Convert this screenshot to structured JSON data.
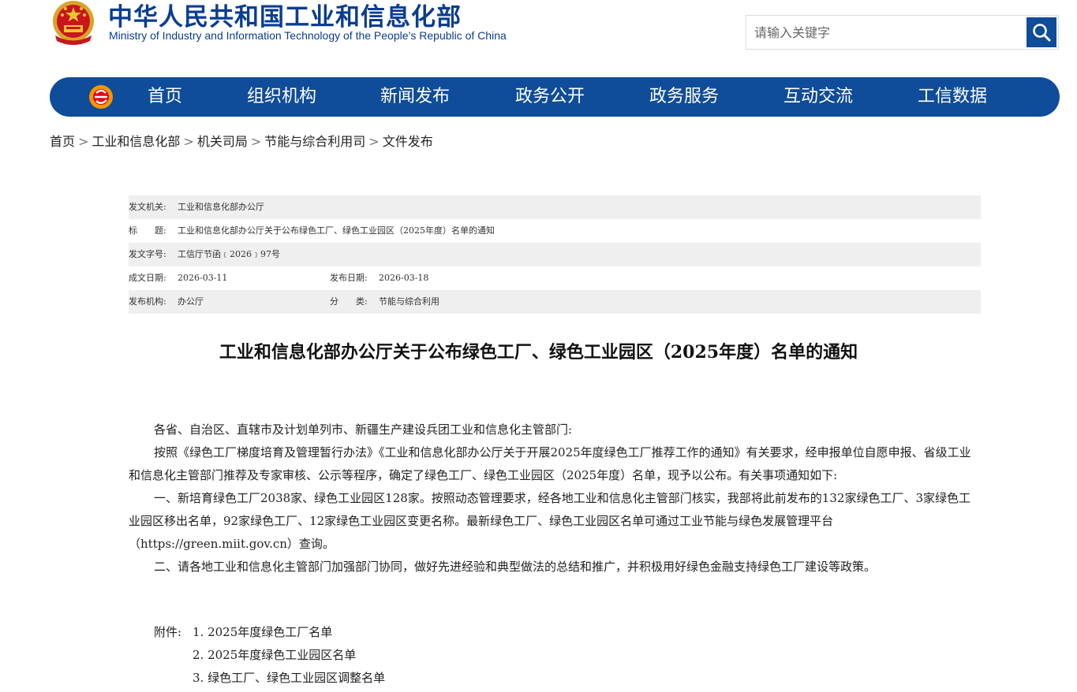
{
  "header": {
    "title_cn": "中华人民共和国工业和信息化部",
    "title_en": "Ministry of Industry and Information Technology of the People’s Republic of China"
  },
  "search": {
    "placeholder": "请输入关键字"
  },
  "nav": {
    "items": [
      "首页",
      "组织机构",
      "新闻发布",
      "政务公开",
      "政务服务",
      "互动交流",
      "工信数据"
    ]
  },
  "breadcrumb": {
    "items": [
      "首页",
      "工业和信息化部",
      "机关司局",
      "节能与综合利用司",
      "文件发布"
    ],
    "separator": ">"
  },
  "meta": {
    "issuer_label": "发文机关:",
    "issuer": "工业和信息化部办公厅",
    "subject_label": "标　　题:",
    "subject": "工业和信息化部办公厅关于公布绿色工厂、绿色工业园区（2025年度）名单的通知",
    "docno_label": "发文字号:",
    "docno": "工信厅节函﹝2026﹞97号",
    "written_label": "成文日期:",
    "written": "2026-03-11",
    "published_label": "发布日期:",
    "published": "2026-03-18",
    "org_label": "发布机构:",
    "org": "办公厅",
    "category_label": "分　　类:",
    "category": "节能与综合利用"
  },
  "article": {
    "title": "工业和信息化部办公厅关于公布绿色工厂、绿色工业园区（2025年度）名单的通知",
    "salutation": "各省、自治区、直辖市及计划单列市、新疆生产建设兵团工业和信息化主管部门:",
    "para1": "按照《绿色工厂梯度培育及管理暂行办法》《工业和信息化部办公厅关于开展2025年度绿色工厂推荐工作的通知》有关要求，经申报单位自愿申报、省级工业和信息化主管部门推荐及专家审核、公示等程序，确定了绿色工厂、绿色工业园区（2025年度）名单，现予以公布。有关事项通知如下:",
    "para2": "一、新培育绿色工厂2038家、绿色工业园区128家。按照动态管理要求，经各地工业和信息化主管部门核实，我部将此前发布的132家绿色工厂、3家绿色工业园区移出名单，92家绿色工厂、12家绿色工业园区变更名称。最新绿色工厂、绿色工业园区名单可通过工业节能与绿色发展管理平台（https://green.miit.gov.cn）查询。",
    "para3": "二、请各地工业和信息化主管部门加强部门协同，做好先进经验和典型做法的总结和推广，并积极用好绿色金融支持绿色工厂建设等政策。",
    "attach_label": "附件:",
    "attachments": [
      "1. 2025年度绿色工厂名单",
      "2. 2025年度绿色工业园区名单",
      "3. 绿色工厂、绿色工业园区调整名单"
    ]
  },
  "colors": {
    "brand_blue": "#0f4c99",
    "title_blue": "#0a3d91",
    "meta_shade": "#efefef"
  }
}
